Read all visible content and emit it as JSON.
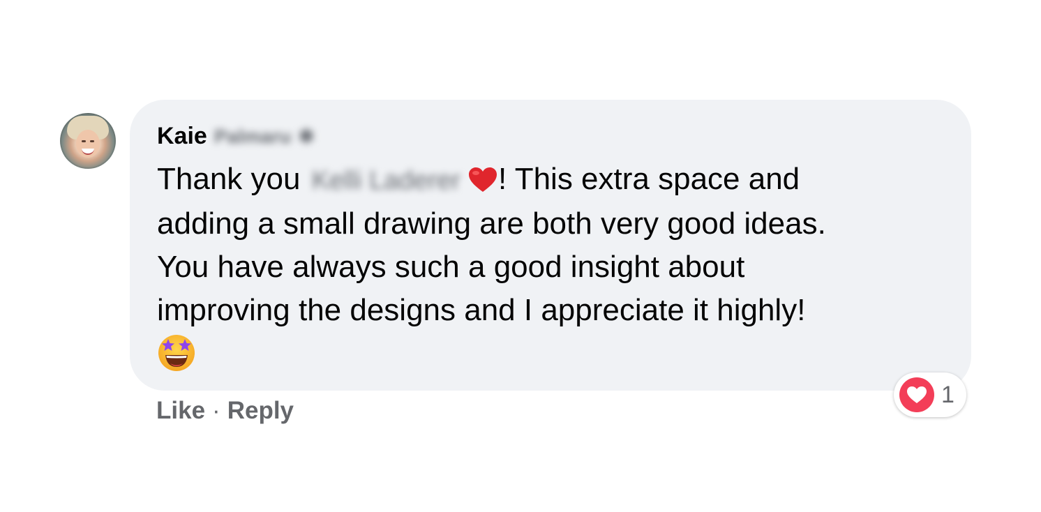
{
  "comment": {
    "author_first_name": "Kaie",
    "author_last_name_blurred": "Palmaru",
    "author_status_glyph": "✱",
    "text_line1_before": "Thank you",
    "mentioned_name_blurred": "Kelli Laderer",
    "text_line1_after": "! This extra space and",
    "text_line2": "adding a small drawing are both very good ideas.",
    "text_line3": "You have always such a good insight about",
    "text_line4": "improving the designs and I appreciate it highly!",
    "emoji_inline": "red-heart",
    "emoji_trailing": "star-struck-face"
  },
  "actions": {
    "like_label": "Like",
    "separator": "·",
    "reply_label": "Reply"
  },
  "reactions": {
    "icon": "heart-reaction-icon",
    "count": "1"
  },
  "colors": {
    "bubble_background": "#f0f2f5",
    "text": "#050505",
    "secondary_text": "#65676b",
    "love_reaction": "#f33e58"
  }
}
